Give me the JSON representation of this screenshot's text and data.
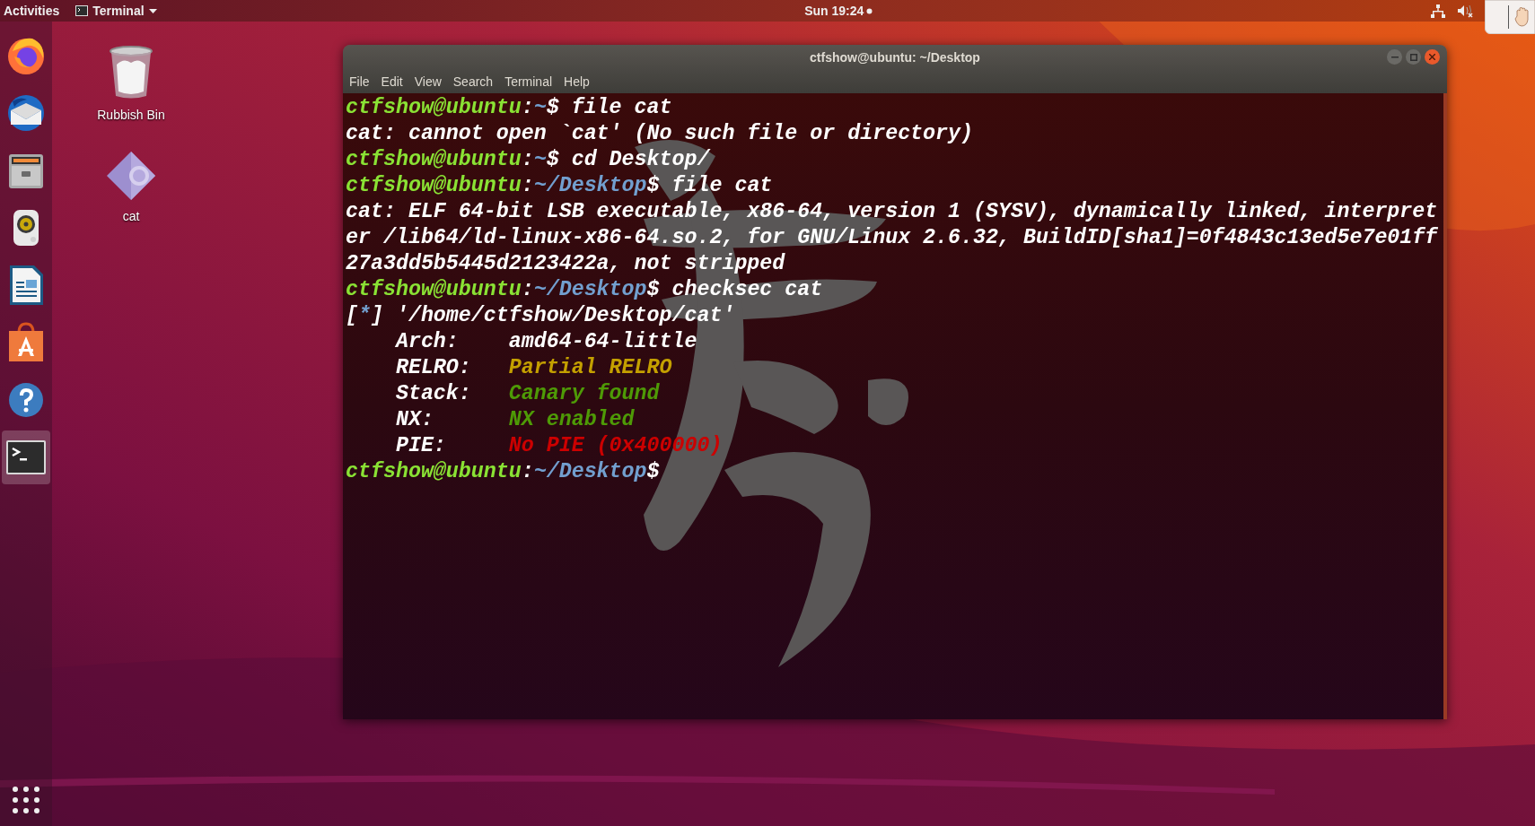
{
  "top_bar": {
    "activities": "Activities",
    "app_menu": "Terminal",
    "clock": "Sun 19:24"
  },
  "dock": {
    "items": [
      {
        "kind": "firefox",
        "selected": false
      },
      {
        "kind": "mail",
        "selected": false
      },
      {
        "kind": "files",
        "selected": false
      },
      {
        "kind": "music",
        "selected": false
      },
      {
        "kind": "writer",
        "selected": false
      },
      {
        "kind": "software",
        "selected": false
      },
      {
        "kind": "help",
        "selected": false
      },
      {
        "kind": "terminal",
        "selected": true
      }
    ]
  },
  "desktop_icons": [
    {
      "kind": "trash",
      "label": "Rubbish Bin"
    },
    {
      "kind": "executable",
      "label": "cat"
    }
  ],
  "terminal": {
    "title": "ctfshow@ubuntu: ~/Desktop",
    "menu": [
      "File",
      "Edit",
      "View",
      "Search",
      "Terminal",
      "Help"
    ],
    "lines": [
      [
        {
          "kind": "user",
          "text": "ctfshow@ubuntu"
        },
        {
          "kind": "plain",
          "text": ":"
        },
        {
          "kind": "path",
          "text": "~"
        },
        {
          "kind": "plain",
          "text": "$ file cat"
        }
      ],
      [
        {
          "kind": "plain",
          "text": "cat: cannot open `cat' (No such file or directory)"
        }
      ],
      [
        {
          "kind": "user",
          "text": "ctfshow@ubuntu"
        },
        {
          "kind": "plain",
          "text": ":"
        },
        {
          "kind": "path",
          "text": "~"
        },
        {
          "kind": "plain",
          "text": "$ cd Desktop/"
        }
      ],
      [
        {
          "kind": "user",
          "text": "ctfshow@ubuntu"
        },
        {
          "kind": "plain",
          "text": ":"
        },
        {
          "kind": "path",
          "text": "~/Desktop"
        },
        {
          "kind": "plain",
          "text": "$ file cat"
        }
      ],
      [
        {
          "kind": "plain",
          "text": "cat: ELF 64-bit LSB executable, x86-64, version 1 (SYSV), dynamically linked, interpret"
        }
      ],
      [
        {
          "kind": "plain",
          "text": "er /lib64/ld-linux-x86-64.so.2, for GNU/Linux 2.6.32, BuildID[sha1]=0f4843c13ed5e7e01ff"
        }
      ],
      [
        {
          "kind": "plain",
          "text": "27a3dd5b5445d2123422a, not stripped"
        }
      ],
      [
        {
          "kind": "user",
          "text": "ctfshow@ubuntu"
        },
        {
          "kind": "plain",
          "text": ":"
        },
        {
          "kind": "path",
          "text": "~/Desktop"
        },
        {
          "kind": "plain",
          "text": "$ checksec cat"
        }
      ],
      [
        {
          "kind": "plain",
          "text": "["
        },
        {
          "kind": "path",
          "text": "*"
        },
        {
          "kind": "plain",
          "text": "] '/home/ctfshow/Desktop/cat'"
        }
      ],
      [
        {
          "kind": "plain",
          "text": "    Arch:    amd64-64-little"
        }
      ],
      [
        {
          "kind": "plain",
          "text": "    RELRO:   "
        },
        {
          "kind": "warn",
          "text": "Partial RELRO"
        }
      ],
      [
        {
          "kind": "plain",
          "text": "    Stack:   "
        },
        {
          "kind": "good",
          "text": "Canary found"
        }
      ],
      [
        {
          "kind": "plain",
          "text": "    NX:      "
        },
        {
          "kind": "good",
          "text": "NX enabled"
        }
      ],
      [
        {
          "kind": "plain",
          "text": "    PIE:     "
        },
        {
          "kind": "bad",
          "text": "No PIE (0x400000)"
        }
      ],
      [
        {
          "kind": "user",
          "text": "ctfshow@ubuntu"
        },
        {
          "kind": "plain",
          "text": ":"
        },
        {
          "kind": "path",
          "text": "~/Desktop"
        },
        {
          "kind": "plain",
          "text": "$"
        }
      ]
    ]
  }
}
